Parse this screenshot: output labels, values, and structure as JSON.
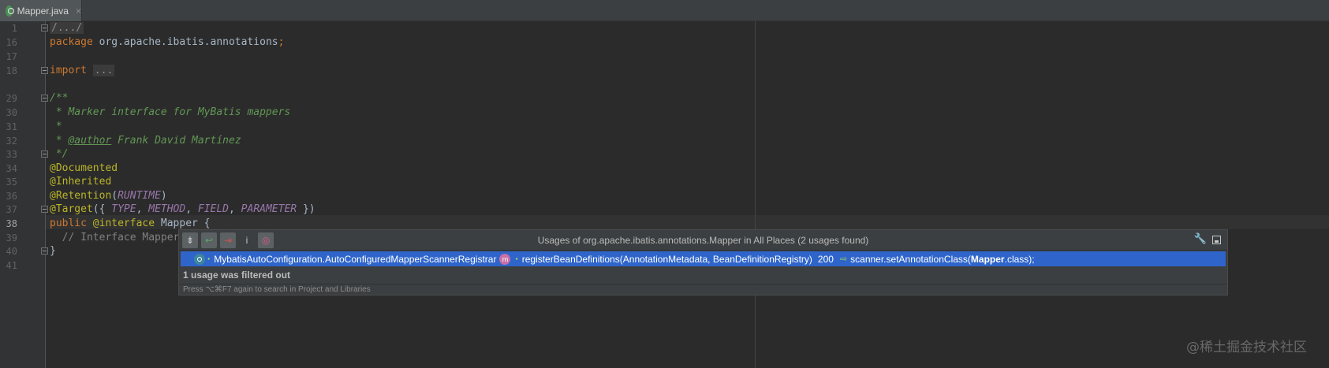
{
  "tab": {
    "label": "Mapper.java",
    "close": "×"
  },
  "gutter": {
    "line_numbers": [
      "1",
      "16",
      "17",
      "18",
      "29",
      "30",
      "31",
      "32",
      "33",
      "34",
      "35",
      "36",
      "37",
      "38",
      "39",
      "40",
      "41"
    ],
    "active_line": "38"
  },
  "code": {
    "l1": "/.../",
    "l16_kw": "package",
    "l16_rest": " org.apache.ibatis.annotations",
    "l16_semi": ";",
    "l18_kw": "import",
    "l18_fold": "...",
    "l29": "/**",
    "l30": " * Marker interface for MyBatis mappers",
    "l31": " *",
    "l32_pre": " * ",
    "l32_tag": "@author",
    "l32_post": " Frank David Martínez",
    "l33": " */",
    "l34": "@Documented",
    "l35": "@Inherited",
    "l36_ann": "@Retention",
    "l36_open": "(",
    "l36_const": "RUNTIME",
    "l36_close": ")",
    "l37_ann": "@Target",
    "l37_open": "({ ",
    "l37_c1": "TYPE",
    "l37_sep1": ", ",
    "l37_c2": "METHOD",
    "l37_sep2": ", ",
    "l37_c3": "FIELD",
    "l37_sep3": ", ",
    "l37_c4": "PARAMETER",
    "l37_close": " })",
    "l38_kw": "public",
    "l38_ann": " @interface",
    "l38_name": " Mapper",
    "l38_brace": " {",
    "l39": "  // Interface Mapper",
    "l40": "}"
  },
  "popup": {
    "title": "Usages of org.apache.ibatis.annotations.Mapper in All Places (2 usages found)",
    "toolbar": {
      "b1": "⇟",
      "b2": "↩",
      "b3": "⇥",
      "b4": "i",
      "b5": "◎"
    },
    "wrench": "🔧",
    "row": {
      "class_small": "⬩",
      "class_name": "MybatisAutoConfiguration.AutoConfiguredMapperScannerRegistrar",
      "method_icon": "m",
      "method_small": "⬩",
      "method": "registerBeanDefinitions(AnnotationMetadata, BeanDefinitionRegistry)",
      "line": "200",
      "arrow": "⇨",
      "code_pre": "scanner.setAnnotationClass(",
      "code_bold": "Mapper",
      "code_post": ".class);"
    },
    "filtered": "1 usage was filtered out",
    "hint": "Press ⌥⌘F7 again to search in Project and Libraries"
  },
  "watermark": "@稀土掘金技术社区"
}
